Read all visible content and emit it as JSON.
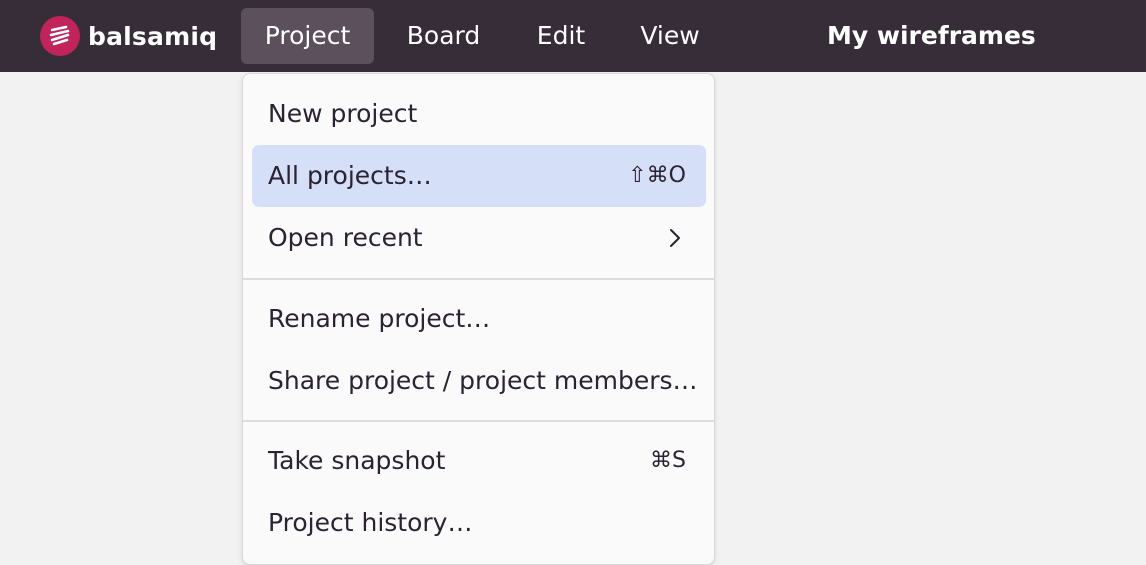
{
  "brand": {
    "name": "balsamiq",
    "logo_icon": "balsamiq-scribble-icon",
    "logo_color": "#c1245a"
  },
  "menubar": {
    "tabs": [
      {
        "label": "Project",
        "active": true
      },
      {
        "label": "Board",
        "active": false
      },
      {
        "label": "Edit",
        "active": false
      },
      {
        "label": "View",
        "active": false
      }
    ]
  },
  "document": {
    "title": "My wireframes"
  },
  "project_menu": {
    "items": [
      {
        "label": "New project",
        "shortcut": ""
      },
      {
        "label": "All projects…",
        "shortcut": "⇧⌘O",
        "highlighted": true
      },
      {
        "label": "Open recent",
        "submenu_icon": "chevron-right-icon"
      },
      {
        "label": "Rename project…",
        "shortcut": ""
      },
      {
        "label": "Share project / project members…",
        "shortcut": ""
      },
      {
        "label": "Take snapshot",
        "shortcut": "⌘S"
      },
      {
        "label": "Project history…",
        "shortcut": ""
      }
    ]
  },
  "colors": {
    "topbar": "#372d38",
    "active_tab": "#5b505c",
    "highlight": "#d5dff7",
    "canvas": "#f2f2f2"
  }
}
